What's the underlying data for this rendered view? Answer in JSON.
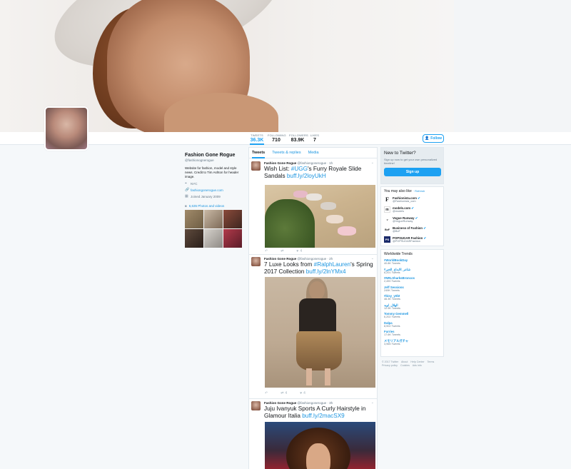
{
  "nav": {
    "stats": [
      {
        "label": "TWEETS",
        "value": "36.3K",
        "active": true
      },
      {
        "label": "FOLLOWING",
        "value": "710",
        "active": false
      },
      {
        "label": "FOLLOWERS",
        "value": "83.9K",
        "active": false
      },
      {
        "label": "LIKES",
        "value": "7",
        "active": false
      }
    ],
    "follow_label": "Follow"
  },
  "profile": {
    "name": "Fashion Gone Rogue",
    "handle": "@fashionognerogue",
    "bio": "Website for fashion, model and style news. Credit to Tim Ashton for header image.",
    "location": "NYC",
    "website": "fashiongonerogue.com",
    "joined": "Joined January 2009",
    "photos_label": "6,635 Photos and videos"
  },
  "timeline": {
    "tabs": [
      "Tweets",
      "Tweets & replies",
      "Media"
    ],
    "tweets": [
      {
        "name": "Fashion Gone Rogue",
        "handle": "@fashiongonerogue · 1h",
        "text_before": "Wish List: ",
        "tag": "#UGG",
        "text_middle": "'s Furry Royale Slide Sandals ",
        "link": "buff.ly/2loyUkH",
        "likes": "4"
      },
      {
        "name": "Fashion Gone Rogue",
        "handle": "@fashiongonerogue · 2h",
        "text_before": "7 Luxe Looks from ",
        "tag": "#RalphLauren",
        "text_middle": "'s Spring 2017 Collection ",
        "link": "buff.ly/2lnYMx4",
        "retweets": "4",
        "likes": "4"
      },
      {
        "name": "Fashion Gone Rogue",
        "handle": "@fashiongonerogue · 3h",
        "text_before": "Juju Ivanyuk Sports A Curly Hairstyle in Glamour Italia ",
        "tag": "",
        "text_middle": "",
        "link": "buff.ly/2macSX9"
      }
    ]
  },
  "signup": {
    "title": "New to Twitter?",
    "text": "Sign up now to get your own personalized timeline!",
    "button": "Sign up"
  },
  "who_to_follow": {
    "title": "You may also like",
    "refresh": "· Refresh",
    "items": [
      {
        "name": "Fashionista.com",
        "handle": "@Fashionista_com",
        "logo": "F"
      },
      {
        "name": "models.com",
        "handle": "@models",
        "logo": "m"
      },
      {
        "name": "Vogue Runway",
        "handle": "@VogueRunway",
        "logo": "V"
      },
      {
        "name": "Business of Fashion",
        "handle": "@BoF",
        "logo": "BoF"
      },
      {
        "name": "POPSUGAR Fashion",
        "handle": "@POPSUGARFashion",
        "logo": "PS"
      }
    ]
  },
  "trends": {
    "title": "Worldwide Trends",
    "items": [
      {
        "name": "#WorldBookDay",
        "count": "40.8K Tweets"
      },
      {
        "name": "#شاعر_الابداع_الخبر",
        "count": "6,201 Tweets"
      },
      {
        "name": "#NRLSharksBroncos",
        "count": "2,490 Tweets"
      },
      {
        "name": "Jeff Sessions",
        "count": "249K Tweets"
      },
      {
        "name": "#bisy_yōbī",
        "count": "46.3K Tweets"
      },
      {
        "name": "الهلال_لويد",
        "count": "12.9K Tweets"
      },
      {
        "name": "Tommy Gemmell",
        "count": "6,202 Tweets"
      },
      {
        "name": "Dalpa",
        "count": "8,902 Tweets"
      },
      {
        "name": "Furries",
        "count": "17.6K Tweets"
      },
      {
        "name": "メモリアルガチャ",
        "count": "3,965 Tweets"
      }
    ]
  },
  "footer": {
    "links": [
      "© 2017 Twitter",
      "About",
      "Help Center",
      "Terms",
      "Privacy policy",
      "Cookies",
      "Ads info"
    ]
  }
}
